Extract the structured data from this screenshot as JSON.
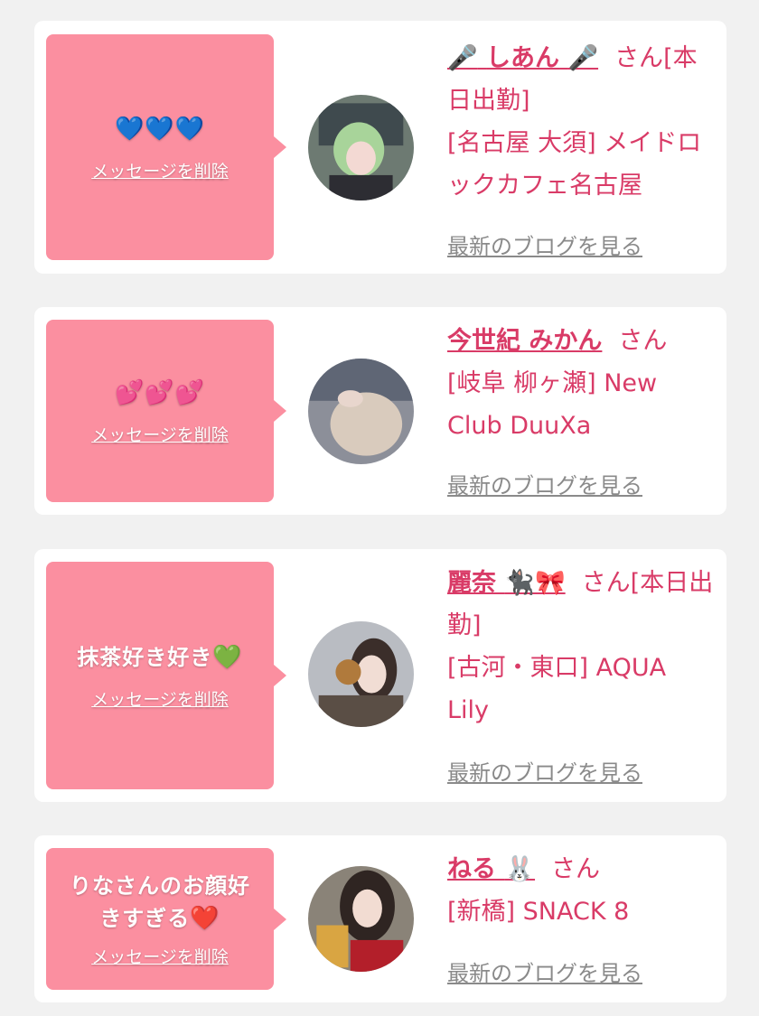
{
  "delete_label": "メッセージを削除",
  "blog_label": "最新のブログを見る",
  "san_suffix": "さん",
  "colors": {
    "page_bg": "#f1f1f1",
    "bubble_bg": "#fb8fa0",
    "accent_pink": "#d93b67",
    "link_gray": "#8a8a8a"
  },
  "entries": [
    {
      "message_emoji": "💙💙💙",
      "cast_name": "しあん",
      "name_emoji_left": "🎤",
      "name_emoji_right": "🎤",
      "tag": "[本日出勤]",
      "shop": "[名古屋 大須] メイドロックカフェ名古屋",
      "avatar_icon": "avatar-photo"
    },
    {
      "message_emoji": "💕💕💕",
      "cast_name": "今世紀 みかん",
      "tag": "",
      "shop": "[岐阜 柳ヶ瀬] New Club DuuXa",
      "avatar_icon": "avatar-photo"
    },
    {
      "message_text": "抹茶好き好き",
      "message_emoji": "💚",
      "cast_name": "麗奈",
      "name_emoji_right": "🐈‍⬛🎀",
      "tag": "[本日出勤]",
      "shop": "[古河・東口] AQUA Lily",
      "avatar_icon": "avatar-photo"
    },
    {
      "message_text": "りなさんのお顔好きすぎる",
      "message_emoji": "❤️",
      "cast_name": "ねる",
      "name_emoji_right": "🐰",
      "tag": "",
      "shop": "[新橋] SNACK 8",
      "avatar_icon": "avatar-photo"
    }
  ]
}
